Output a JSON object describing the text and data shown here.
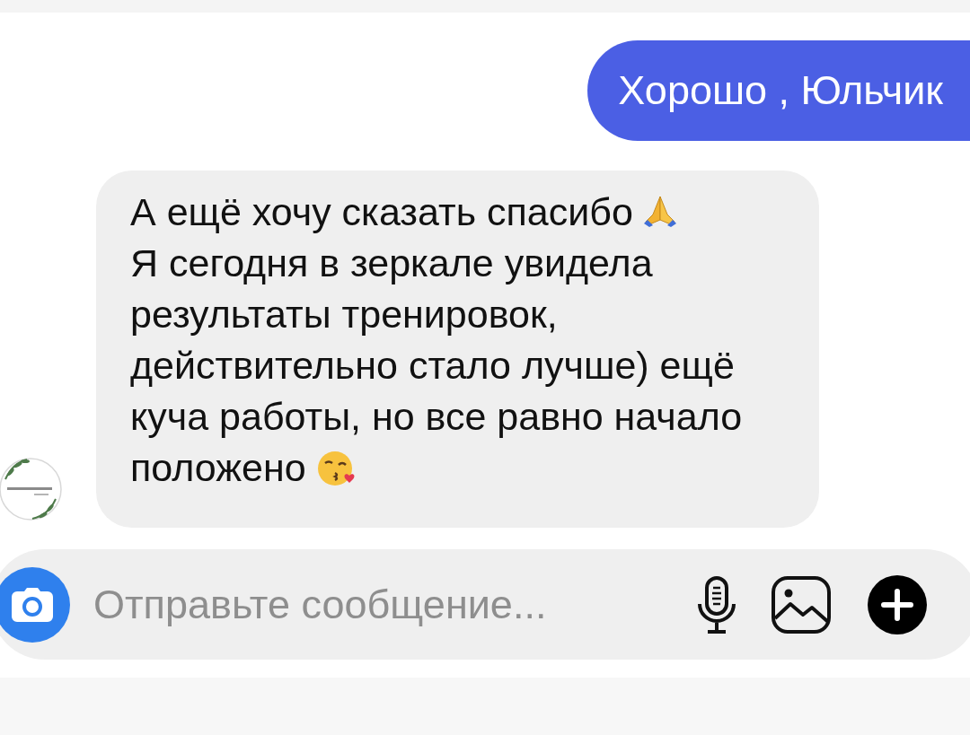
{
  "sent_message": {
    "text": "Хорошо , Юльчик"
  },
  "received_message": {
    "lines": [
      "А ещё хочу сказать спасибо",
      "Я сегодня в зеркале увидела",
      "результаты тренировок,",
      "действительно стало лучше) ещё",
      "куча работы, но все равно начало",
      "положено"
    ]
  },
  "composer": {
    "placeholder": "Отправьте сообщение..."
  }
}
